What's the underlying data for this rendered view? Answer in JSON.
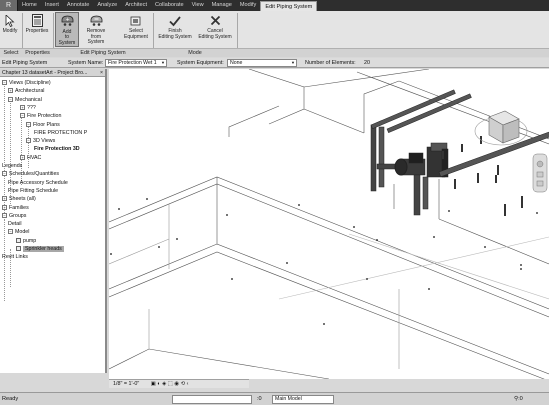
{
  "ribbon_tabs": [
    "Home",
    "Insert",
    "Annotate",
    "Analyze",
    "Architect",
    "Collaborate",
    "View",
    "Manage",
    "Modify",
    "Edit Piping System"
  ],
  "active_tab_index": 9,
  "ribbon_buttons": {
    "modify": "Modify",
    "properties": "Properties",
    "add_line1": "Add",
    "add_line2": "to System",
    "remove_line1": "Remove",
    "remove_line2": "from System",
    "select_line1": "Select",
    "select_line2": "Equipment",
    "finish_line1": "Finish",
    "finish_line2": "Editing System",
    "cancel_line1": "Cancel",
    "cancel_line2": "Editing System"
  },
  "ribbon_groups": {
    "select": "Select",
    "properties": "Properties",
    "edit": "Edit Piping System",
    "mode": "Mode"
  },
  "options_bar": {
    "context": "Edit Piping System",
    "system_name_label": "System Name:",
    "system_name_value": "Fire Protection Wet 1",
    "system_equipment_label": "System Equipment:",
    "system_equipment_value": "None",
    "num_elements_label": "Number of Elements:",
    "num_elements_value": "20"
  },
  "browser": {
    "title": "Chapter 13 datasetArt - Project Bro...",
    "close": "×",
    "tree": [
      {
        "label": "Views (Discipline)",
        "toggle": "−"
      },
      {
        "label": "Architectural",
        "toggle": "+"
      },
      {
        "label": "Mechanical",
        "toggle": "−"
      },
      {
        "label": "???",
        "toggle": "+"
      },
      {
        "label": "Fire Protection",
        "toggle": "−"
      },
      {
        "label": "Floor Plans",
        "toggle": "−"
      },
      {
        "label": "FIRE PROTECTION P",
        "toggle": ""
      },
      {
        "label": "3D Views",
        "toggle": "−"
      },
      {
        "label": "Fire Protection 3D",
        "toggle": ""
      },
      {
        "label": "HVAC",
        "toggle": "+"
      },
      {
        "label": "Legends",
        "toggle": ""
      },
      {
        "label": "Schedules/Quantities",
        "toggle": "−"
      },
      {
        "label": "Pipe Accessory Schedule",
        "toggle": ""
      },
      {
        "label": "Pipe Fitting Schedule",
        "toggle": ""
      },
      {
        "label": "Sheets (all)",
        "toggle": "+"
      },
      {
        "label": "Families",
        "toggle": "+"
      },
      {
        "label": "Groups",
        "toggle": "−"
      },
      {
        "label": "Detail",
        "toggle": ""
      },
      {
        "label": "Model",
        "toggle": "−"
      },
      {
        "label": "pump",
        "toggle": ""
      },
      {
        "label": "Sprinkler heads",
        "toggle": ""
      },
      {
        "label": "Revit Links",
        "toggle": ""
      }
    ]
  },
  "view_control": {
    "scale": "1/8\" = 1'-0\""
  },
  "status_bar": {
    "text": "Ready",
    "workset_value": "",
    "zero": ":0",
    "model_value": "Main Model"
  }
}
